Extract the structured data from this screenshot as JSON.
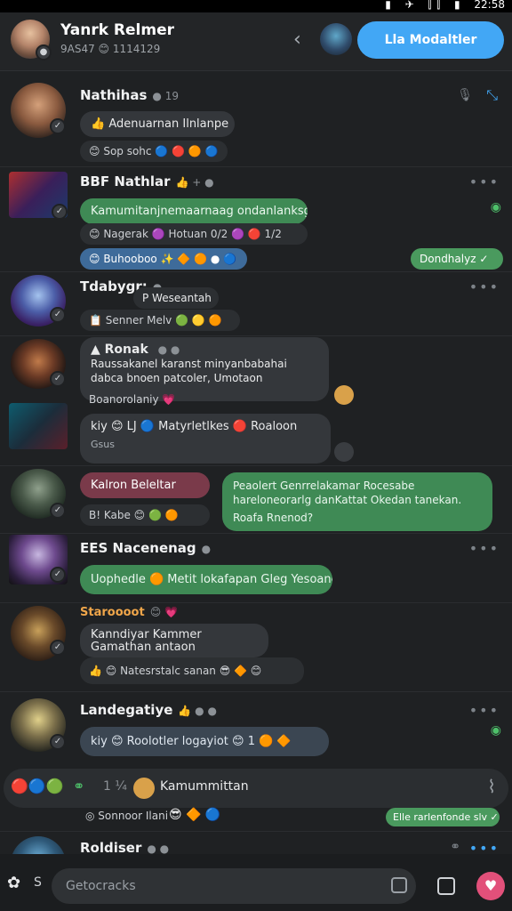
{
  "status": {
    "time": "22:58"
  },
  "header": {
    "title": "Yanrk Relmer",
    "subtitle": "9AS47 😊 1114129",
    "action_label": "Lla Modaltler"
  },
  "feed": [
    {
      "sender": "Nathihas",
      "meta": "● 19",
      "bubble": "👍 Adenuarnan Ilnlanpe",
      "reactions": "😊 Sop sohc 🔵 🔴 🟠 🔵"
    },
    {
      "sender": "BBF Nathlar",
      "meta": "👍 + ●",
      "bubble": "Kamumitanjnemaarnaag ondanlanksg",
      "reactions": "😊 Nagerak 🟣 Hotuan 0/2 🟣 🔴 1/2",
      "reactions2": "😊 Buhooboo ✨ 🔶 🟠 ● 🔵",
      "right_bubble": "Dondhalyz ✓"
    },
    {
      "sender": "Tdabygr:",
      "meta": "●",
      "bubble": "P Weseantah",
      "reactions": "📋 Senner Melv 🟢 🟡 🟠"
    },
    {
      "sender": "Ronak",
      "meta": "● ●",
      "bubble": "Raussakanel karanst minyanbabahai dabca bnoen patcoler, Umotaon",
      "reactions": "Boanorolaniy 💗"
    },
    {
      "sender": "",
      "bubble": "kiy 😊 LJ 🔵 Matyrletlkes 🔴 Roaloon",
      "sub": "Gsus"
    },
    {
      "sender": "",
      "bubble": "Kalron Beleltar",
      "reactions": "B! Kabe 😊 🟢 🟠",
      "right_bubble": "Peaolert Genrrelakamar Rocesabe hareloneorarlg danKattat Okedan tanekan.",
      "right_sub": "Roafa Rnenod?"
    },
    {
      "sender": "EES Nacenenag",
      "meta": "●",
      "bubble": "Uophedle 🟠 Metit lokafapan Gleg Yesoanel"
    },
    {
      "sender": "Staroooot",
      "meta": "😊 💗",
      "bubble": "Kanndiyar Kammer Gamathan antaon",
      "reactions": "👍 😊 Natesrstalc sanan 😎 🔶 😊"
    },
    {
      "sender": "Landegatiye",
      "meta": "👍 ● ●",
      "bubble": "kiy 😊 Roolotler logayiot 😊 1 🟠 🔶"
    }
  ],
  "composer": {
    "count": "1 ¼",
    "label": "Kamummittan"
  },
  "tray": {
    "left": "◎ Sonnoor Ilani",
    "right": "Elle rarlenfonde slv ✓"
  },
  "last": {
    "sender": "Roldiser",
    "meta": "● ●"
  },
  "bottom": {
    "placeholder": "Getocracks",
    "left_label": "S"
  }
}
